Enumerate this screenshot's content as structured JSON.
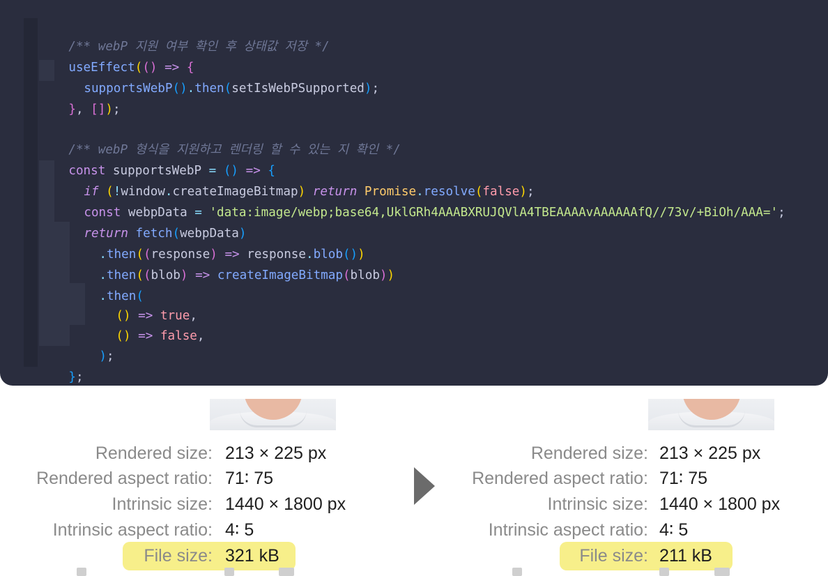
{
  "code": {
    "comment1": "/** webP 지원 여부 확인 후 상태값 저장 */",
    "l2_fn": "useEffect",
    "l2_paren_open": "(",
    "l2_args": "()",
    "l2_arrow": " => ",
    "l2_brace": "{",
    "l3_fn": "supportsWebP",
    "l3_call": "()",
    "l3_dot": ".",
    "l3_then": "then",
    "l3_po": "(",
    "l3_arg": "setIsWebPSupported",
    "l3_pc": ")",
    "l3_semi": ";",
    "l4_brace": "}",
    "l4_comma": ", ",
    "l4_arr": "[]",
    "l4_pc": ")",
    "l4_semi": ";",
    "comment2": "/** webP 형식을 지원하고 렌더링 할 수 있는 지 확인 */",
    "l6_const": "const",
    "l6_name": " supportsWebP ",
    "l6_eq": "=",
    "l6_sp": " ",
    "l6_args": "()",
    "l6_arrow": " => ",
    "l6_brace": "{",
    "l7_if": "if",
    "l7_sp": " ",
    "l7_po": "(",
    "l7_not": "!",
    "l7_win": "window",
    "l7_dot": ".",
    "l7_fn": "createImageBitmap",
    "l7_pc": ")",
    "l7_sp2": " ",
    "l7_return": "return",
    "l7_sp3": " ",
    "l7_promise": "Promise",
    "l7_dot2": ".",
    "l7_resolve": "resolve",
    "l7_po2": "(",
    "l7_false": "false",
    "l7_pc2": ")",
    "l7_semi": ";",
    "l8_const": "const",
    "l8_name": " webpData ",
    "l8_eq": "=",
    "l8_sp": " ",
    "l8_str": "'data:image/webp;base64,UklGRh4AAABXRUJQVlA4TBEAAAAvAAAAAAfQ//73v/+BiOh/AAA='",
    "l8_semi": ";",
    "l9_return": "return",
    "l9_sp": " ",
    "l9_fetch": "fetch",
    "l9_po": "(",
    "l9_arg": "webpData",
    "l9_pc": ")",
    "l10_dot": ".",
    "l10_then": "then",
    "l10_po": "(",
    "l10_po2": "(",
    "l10_param": "response",
    "l10_pc2": ")",
    "l10_arrow": " => ",
    "l10_obj": "response",
    "l10_dot2": ".",
    "l10_blob": "blob",
    "l10_call": "()",
    "l10_pc": ")",
    "l11_dot": ".",
    "l11_then": "then",
    "l11_po": "(",
    "l11_po2": "(",
    "l11_param": "blob",
    "l11_pc2": ")",
    "l11_arrow": " => ",
    "l11_fn": "createImageBitmap",
    "l11_po3": "(",
    "l11_arg": "blob",
    "l11_pc3": ")",
    "l11_pc": ")",
    "l12_dot": ".",
    "l12_then": "then",
    "l12_po": "(",
    "l13_args": "()",
    "l13_arrow": " => ",
    "l13_val": "true",
    "l13_comma": ",",
    "l14_args": "()",
    "l14_arrow": " => ",
    "l14_val": "false",
    "l14_comma": ",",
    "l15_pc": ")",
    "l15_semi": ";",
    "l16_brace": "}",
    "l16_semi": ";"
  },
  "panels": [
    {
      "rendered_size_label": "Rendered size:",
      "rendered_size_value": "213 × 225 px",
      "rendered_ratio_label": "Rendered aspect ratio:",
      "rendered_ratio_value": "71∶ 75",
      "intrinsic_size_label": "Intrinsic size:",
      "intrinsic_size_value": "1440 × 1800 px",
      "intrinsic_ratio_label": "Intrinsic aspect ratio:",
      "intrinsic_ratio_value": "4∶ 5",
      "file_size_label": "File size:",
      "file_size_value": "321 kB"
    },
    {
      "rendered_size_label": "Rendered size:",
      "rendered_size_value": "213 × 225 px",
      "rendered_ratio_label": "Rendered aspect ratio:",
      "rendered_ratio_value": "71∶ 75",
      "intrinsic_size_label": "Intrinsic size:",
      "intrinsic_size_value": "1440 × 1800 px",
      "intrinsic_ratio_label": "Intrinsic aspect ratio:",
      "intrinsic_ratio_value": "4∶ 5",
      "file_size_label": "File size:",
      "file_size_value": "211 kB"
    }
  ],
  "colors": {
    "editor_bg": "#2a2d3e",
    "highlight": "#f7ef8a",
    "label": "#8a8a8a",
    "value": "#1f1f1f"
  },
  "icons": {
    "arrow": "play-triangle-icon"
  }
}
